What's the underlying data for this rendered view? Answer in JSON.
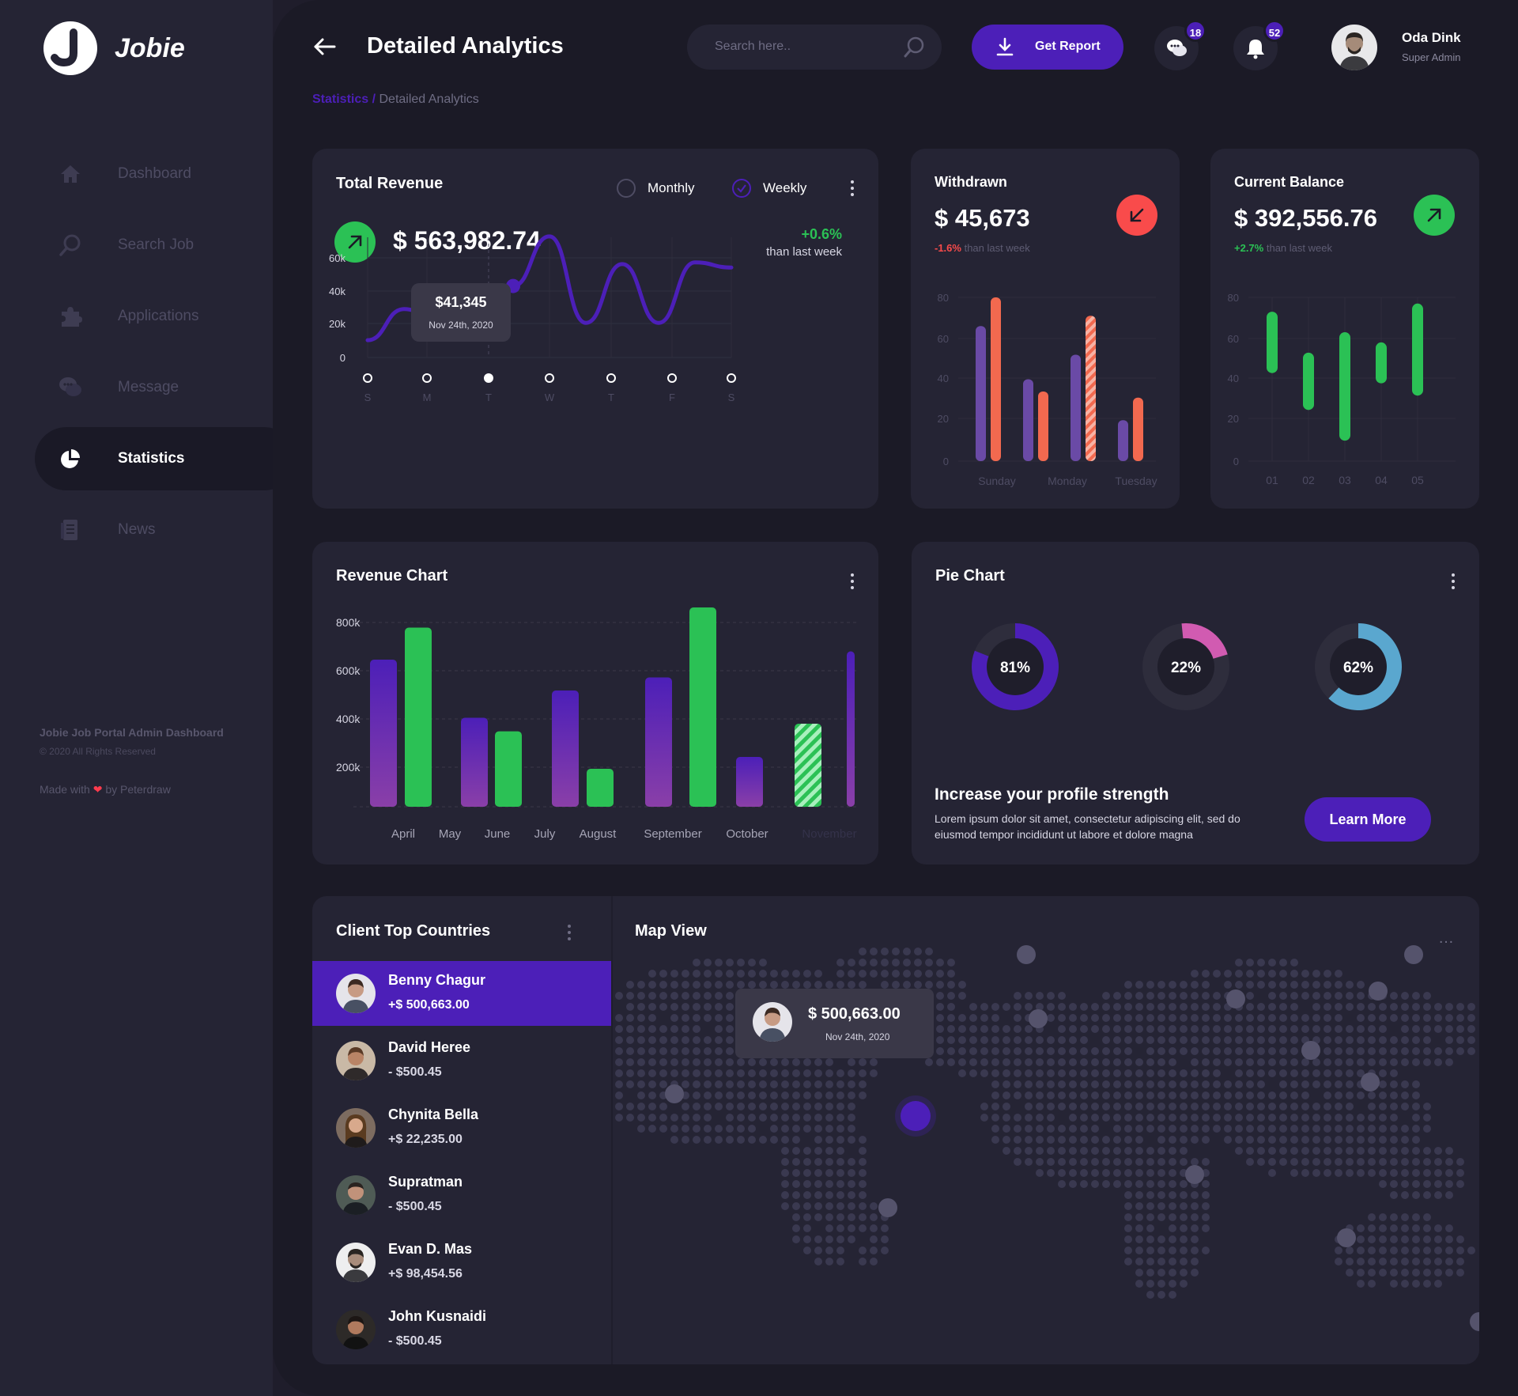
{
  "brand": {
    "name": "Jobie"
  },
  "sidebar": {
    "items": [
      {
        "label": "Dashboard",
        "icon": "home-icon",
        "active": false
      },
      {
        "label": "Search Job",
        "icon": "search-icon",
        "active": false
      },
      {
        "label": "Applications",
        "icon": "puzzle-icon",
        "active": false
      },
      {
        "label": "Message",
        "icon": "chat-icon",
        "active": false
      },
      {
        "label": "Statistics",
        "icon": "pie-chart-icon",
        "active": true
      },
      {
        "label": "News",
        "icon": "news-icon",
        "active": false
      }
    ],
    "footer": {
      "title": "Jobie Job Portal Admin Dashboard",
      "copyright": "© 2020 All Rights Reserved",
      "made_prefix": "Made with",
      "made_suffix": "by Peterdraw"
    }
  },
  "header": {
    "title": "Detailed Analytics",
    "search_placeholder": "Search here..",
    "report_label": "Get Report",
    "messages_count": "18",
    "notifications_count": "52",
    "user_name": "Oda Dink",
    "user_role": "Super Admin"
  },
  "breadcrumb": {
    "parent": "Statistics /",
    "current": "Detailed Analytics"
  },
  "total_revenue": {
    "title": "Total Revenue",
    "toggle_monthly": "Monthly",
    "toggle_weekly": "Weekly",
    "selected": "Weekly",
    "amount": "$ 563,982.74",
    "change": "+0.6%",
    "change_note": "than last week",
    "tooltip_value": "$41,345",
    "tooltip_date": "Nov 24th, 2020",
    "chart_data": {
      "type": "line",
      "categories": [
        "S",
        "M",
        "T",
        "W",
        "T",
        "F",
        "S"
      ],
      "y_ticks": [
        "60k",
        "40k",
        "20k",
        "0"
      ],
      "ylim": [
        0,
        75000
      ],
      "active_index": 2,
      "series": [
        {
          "values": [
            10000,
            28000,
            20000,
            40000,
            41345,
            70000,
            20000,
            54000,
            20000,
            55000,
            52000
          ]
        }
      ]
    }
  },
  "withdrawn": {
    "title": "Withdrawn",
    "amount": "$ 45,673",
    "change": "-1.6%",
    "change_note": "than last week",
    "chart_data": {
      "type": "bar",
      "categories": [
        "Sunday",
        "Monday",
        "Tuesday"
      ],
      "y_ticks": [
        "80",
        "60",
        "40",
        "20",
        "0"
      ],
      "ylim": [
        0,
        80
      ],
      "bars": [
        66,
        80,
        40,
        34,
        52,
        71,
        20,
        31
      ],
      "colors": [
        "#6a4aa6",
        "#f2694f",
        "#6a4aa6",
        "#f2694f",
        "#6a4aa6",
        "#f2694f",
        "#6a4aa6",
        "#f2694f"
      ]
    }
  },
  "balance": {
    "title": "Current Balance",
    "amount": "$ 392,556.76",
    "change": "+2.7%",
    "change_note": "than last week",
    "chart_data": {
      "type": "bar",
      "categories": [
        "01",
        "02",
        "03",
        "04",
        "05"
      ],
      "y_ticks": [
        "80",
        "60",
        "40",
        "20",
        "0"
      ],
      "ylim": [
        0,
        80
      ],
      "ranges": [
        [
          43,
          73
        ],
        [
          25,
          53
        ],
        [
          10,
          63
        ],
        [
          38,
          58
        ],
        [
          32,
          77
        ]
      ]
    }
  },
  "revenue_chart": {
    "title": "Revenue Chart",
    "chart_data": {
      "type": "bar",
      "categories": [
        "April",
        "May",
        "June",
        "July",
        "August",
        "September",
        "October",
        "November"
      ],
      "y_ticks": [
        "800k",
        "600k",
        "400k",
        "200k"
      ],
      "ylim": [
        0,
        850000
      ],
      "series": [
        {
          "values": [
            620000,
            375000,
            490000,
            545000,
            210000,
            655000
          ]
        },
        {
          "values": [
            755000,
            318000,
            160000,
            840000,
            350000
          ]
        }
      ]
    }
  },
  "pie_chart": {
    "title": "Pie Chart",
    "chart_data": {
      "type": "pie",
      "values": [
        81,
        22,
        62
      ],
      "labels": [
        "81%",
        "22%",
        "62%"
      ],
      "colors": [
        "#4c1fb8",
        "#d15bb1",
        "#5aa7cf"
      ]
    },
    "promo_title": "Increase your profile strength",
    "promo_text": "Lorem ipsum dolor sit amet, consectetur adipiscing elit, sed do eiusmod tempor incididunt ut labore et dolore magna",
    "learn_more": "Learn More"
  },
  "countries": {
    "title": "Client Top Countries",
    "items": [
      {
        "name": "Benny Chagur",
        "value": "+$ 500,663.00",
        "active": true
      },
      {
        "name": "David Heree",
        "value": "- $500.45",
        "active": false
      },
      {
        "name": "Chynita Bella",
        "value": "+$ 22,235.00",
        "active": false
      },
      {
        "name": "Supratman",
        "value": "- $500.45",
        "active": false
      },
      {
        "name": "Evan D. Mas",
        "value": "+$ 98,454.56",
        "active": false
      },
      {
        "name": "John Kusnaidi",
        "value": "- $500.45",
        "active": false
      }
    ]
  },
  "map": {
    "title": "Map View",
    "tooltip_value": "$ 500,663.00",
    "tooltip_date": "Nov 24th, 2020"
  }
}
